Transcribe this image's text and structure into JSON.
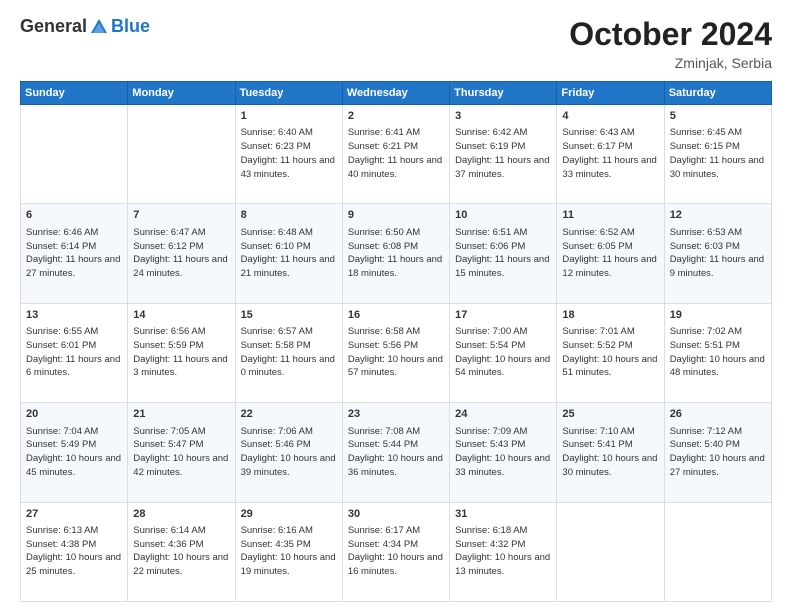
{
  "logo": {
    "general": "General",
    "blue": "Blue"
  },
  "header": {
    "month": "October 2024",
    "location": "Zminjak, Serbia"
  },
  "weekdays": [
    "Sunday",
    "Monday",
    "Tuesday",
    "Wednesday",
    "Thursday",
    "Friday",
    "Saturday"
  ],
  "weeks": [
    [
      {
        "day": "",
        "info": ""
      },
      {
        "day": "",
        "info": ""
      },
      {
        "day": "1",
        "info": "Sunrise: 6:40 AM\nSunset: 6:23 PM\nDaylight: 11 hours and 43 minutes."
      },
      {
        "day": "2",
        "info": "Sunrise: 6:41 AM\nSunset: 6:21 PM\nDaylight: 11 hours and 40 minutes."
      },
      {
        "day": "3",
        "info": "Sunrise: 6:42 AM\nSunset: 6:19 PM\nDaylight: 11 hours and 37 minutes."
      },
      {
        "day": "4",
        "info": "Sunrise: 6:43 AM\nSunset: 6:17 PM\nDaylight: 11 hours and 33 minutes."
      },
      {
        "day": "5",
        "info": "Sunrise: 6:45 AM\nSunset: 6:15 PM\nDaylight: 11 hours and 30 minutes."
      }
    ],
    [
      {
        "day": "6",
        "info": "Sunrise: 6:46 AM\nSunset: 6:14 PM\nDaylight: 11 hours and 27 minutes."
      },
      {
        "day": "7",
        "info": "Sunrise: 6:47 AM\nSunset: 6:12 PM\nDaylight: 11 hours and 24 minutes."
      },
      {
        "day": "8",
        "info": "Sunrise: 6:48 AM\nSunset: 6:10 PM\nDaylight: 11 hours and 21 minutes."
      },
      {
        "day": "9",
        "info": "Sunrise: 6:50 AM\nSunset: 6:08 PM\nDaylight: 11 hours and 18 minutes."
      },
      {
        "day": "10",
        "info": "Sunrise: 6:51 AM\nSunset: 6:06 PM\nDaylight: 11 hours and 15 minutes."
      },
      {
        "day": "11",
        "info": "Sunrise: 6:52 AM\nSunset: 6:05 PM\nDaylight: 11 hours and 12 minutes."
      },
      {
        "day": "12",
        "info": "Sunrise: 6:53 AM\nSunset: 6:03 PM\nDaylight: 11 hours and 9 minutes."
      }
    ],
    [
      {
        "day": "13",
        "info": "Sunrise: 6:55 AM\nSunset: 6:01 PM\nDaylight: 11 hours and 6 minutes."
      },
      {
        "day": "14",
        "info": "Sunrise: 6:56 AM\nSunset: 5:59 PM\nDaylight: 11 hours and 3 minutes."
      },
      {
        "day": "15",
        "info": "Sunrise: 6:57 AM\nSunset: 5:58 PM\nDaylight: 11 hours and 0 minutes."
      },
      {
        "day": "16",
        "info": "Sunrise: 6:58 AM\nSunset: 5:56 PM\nDaylight: 10 hours and 57 minutes."
      },
      {
        "day": "17",
        "info": "Sunrise: 7:00 AM\nSunset: 5:54 PM\nDaylight: 10 hours and 54 minutes."
      },
      {
        "day": "18",
        "info": "Sunrise: 7:01 AM\nSunset: 5:52 PM\nDaylight: 10 hours and 51 minutes."
      },
      {
        "day": "19",
        "info": "Sunrise: 7:02 AM\nSunset: 5:51 PM\nDaylight: 10 hours and 48 minutes."
      }
    ],
    [
      {
        "day": "20",
        "info": "Sunrise: 7:04 AM\nSunset: 5:49 PM\nDaylight: 10 hours and 45 minutes."
      },
      {
        "day": "21",
        "info": "Sunrise: 7:05 AM\nSunset: 5:47 PM\nDaylight: 10 hours and 42 minutes."
      },
      {
        "day": "22",
        "info": "Sunrise: 7:06 AM\nSunset: 5:46 PM\nDaylight: 10 hours and 39 minutes."
      },
      {
        "day": "23",
        "info": "Sunrise: 7:08 AM\nSunset: 5:44 PM\nDaylight: 10 hours and 36 minutes."
      },
      {
        "day": "24",
        "info": "Sunrise: 7:09 AM\nSunset: 5:43 PM\nDaylight: 10 hours and 33 minutes."
      },
      {
        "day": "25",
        "info": "Sunrise: 7:10 AM\nSunset: 5:41 PM\nDaylight: 10 hours and 30 minutes."
      },
      {
        "day": "26",
        "info": "Sunrise: 7:12 AM\nSunset: 5:40 PM\nDaylight: 10 hours and 27 minutes."
      }
    ],
    [
      {
        "day": "27",
        "info": "Sunrise: 6:13 AM\nSunset: 4:38 PM\nDaylight: 10 hours and 25 minutes."
      },
      {
        "day": "28",
        "info": "Sunrise: 6:14 AM\nSunset: 4:36 PM\nDaylight: 10 hours and 22 minutes."
      },
      {
        "day": "29",
        "info": "Sunrise: 6:16 AM\nSunset: 4:35 PM\nDaylight: 10 hours and 19 minutes."
      },
      {
        "day": "30",
        "info": "Sunrise: 6:17 AM\nSunset: 4:34 PM\nDaylight: 10 hours and 16 minutes."
      },
      {
        "day": "31",
        "info": "Sunrise: 6:18 AM\nSunset: 4:32 PM\nDaylight: 10 hours and 13 minutes."
      },
      {
        "day": "",
        "info": ""
      },
      {
        "day": "",
        "info": ""
      }
    ]
  ]
}
